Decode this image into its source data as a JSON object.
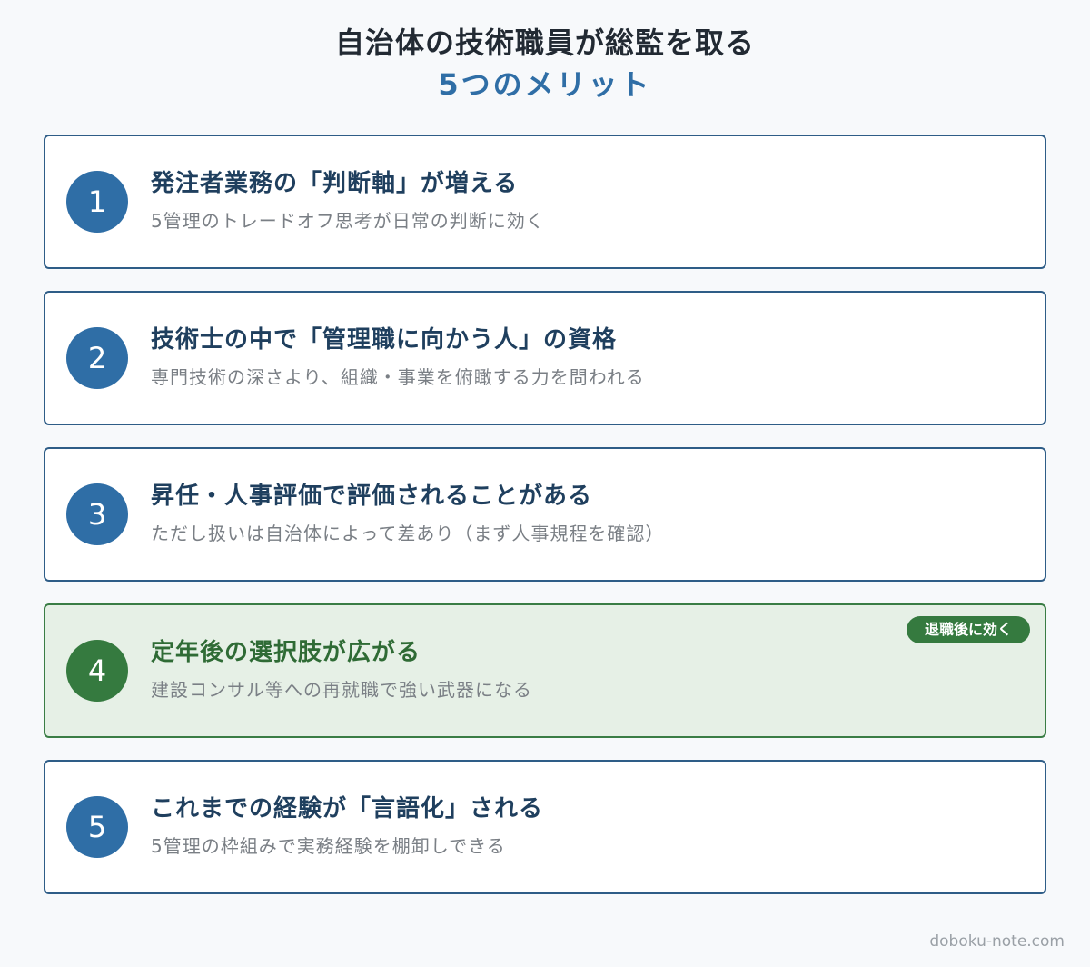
{
  "title": {
    "line1": "自治体の技術職員が総監を取る",
    "line2": "5つのメリット"
  },
  "cards": [
    {
      "number": "1",
      "heading": "発注者業務の「判断軸」が増える",
      "sub": "5管理のトレードオフ思考が日常の判断に効く"
    },
    {
      "number": "2",
      "heading": "技術士の中で「管理職に向かう人」の資格",
      "sub": "専門技術の深さより、組織・事業を俯瞰する力を問われる"
    },
    {
      "number": "3",
      "heading": "昇任・人事評価で評価されることがある",
      "sub": "ただし扱いは自治体によって差あり（まず人事規程を確認）"
    },
    {
      "number": "4",
      "heading": "定年後の選択肢が広がる",
      "sub": "建設コンサル等への再就職で強い武器になる",
      "badge": "退職後に効く"
    },
    {
      "number": "5",
      "heading": "これまでの経験が「言語化」される",
      "sub": "5管理の枠組みで実務経験を棚卸しできる"
    }
  ],
  "footer": "doboku-note.com",
  "colors": {
    "accent_blue": "#2f6ea6",
    "accent_green": "#357a3f",
    "highlight_bg": "#e6f0e6"
  }
}
